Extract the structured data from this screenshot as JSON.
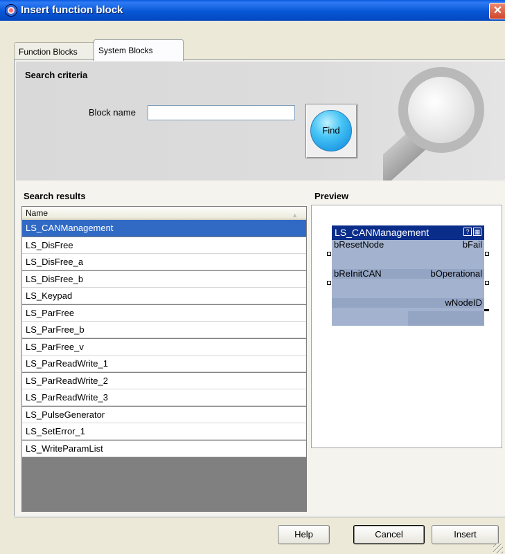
{
  "window": {
    "title": "Insert function block",
    "close_glyph": "✕",
    "icon": "app-icon"
  },
  "tabs": [
    {
      "label": "Function Blocks",
      "active": false
    },
    {
      "label": "System Blocks",
      "active": true
    }
  ],
  "criteria": {
    "title": "Search criteria",
    "block_name_label": "Block name",
    "block_name_value": "",
    "find_label": "Find"
  },
  "results": {
    "title": "Search results",
    "column_header": "Name",
    "sort_glyph": "▲",
    "selected_index": 0,
    "items": [
      "LS_CANManagement",
      "LS_DisFree",
      "LS_DisFree_a",
      "LS_DisFree_b",
      "LS_Keypad",
      "LS_ParFree",
      "LS_ParFree_b",
      "LS_ParFree_v",
      "LS_ParReadWrite_1",
      "LS_ParReadWrite_2",
      "LS_ParReadWrite_3",
      "LS_PulseGenerator",
      "LS_SetError_1",
      "LS_WriteParamList"
    ]
  },
  "preview": {
    "title": "Preview",
    "block": {
      "name": "LS_CANManagement",
      "help_glyph": "?",
      "props_glyph": "▦",
      "inputs": [
        "bResetNode",
        "bReInitCAN"
      ],
      "outputs": [
        "bFail",
        "bOperational",
        "wNodeID"
      ]
    }
  },
  "buttons": {
    "help": "Help",
    "cancel": "Cancel",
    "insert": "Insert"
  },
  "colors": {
    "titlebar": "#0757d6",
    "selection": "#316ac5",
    "block_header": "#0a2d8a",
    "block_body": "#a3b3cf"
  }
}
